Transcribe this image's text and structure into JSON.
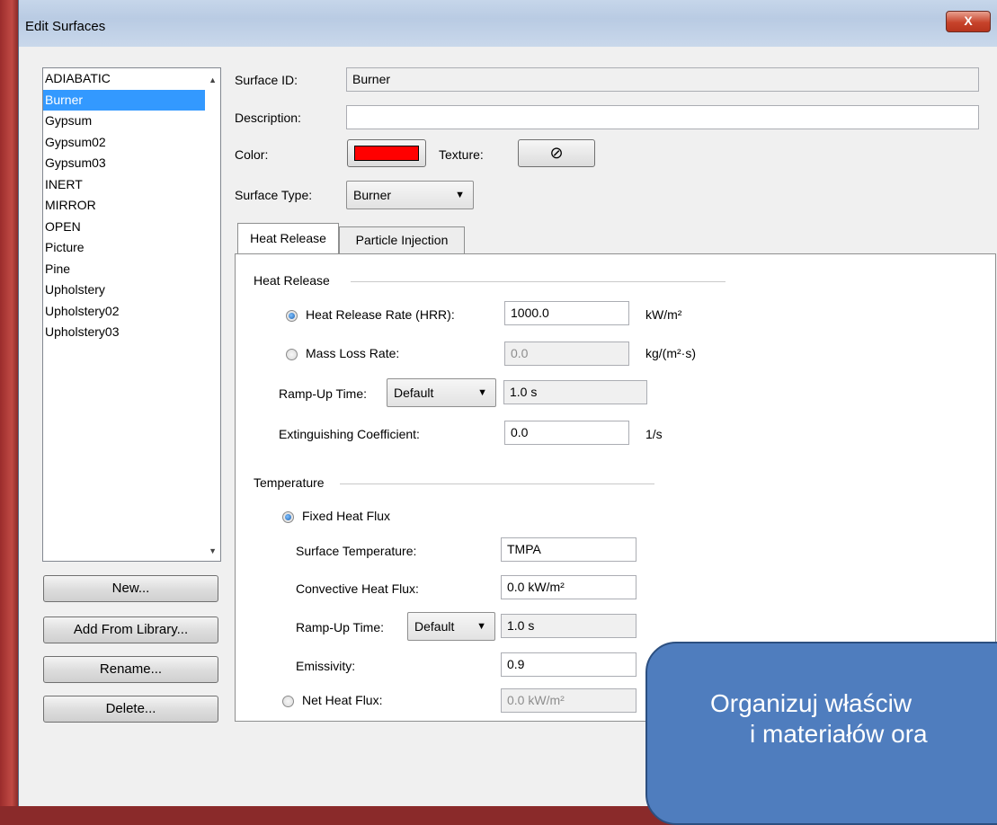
{
  "window": {
    "title": "Edit Surfaces",
    "close_glyph": "X"
  },
  "surface_list": {
    "items": [
      "ADIABATIC",
      "Burner",
      "Gypsum",
      "Gypsum02",
      "Gypsum03",
      "INERT",
      "MIRROR",
      "OPEN",
      "Picture",
      "Pine",
      "Upholstery",
      "Upholstery02",
      "Upholstery03"
    ],
    "selected_index": 1
  },
  "buttons": {
    "new": "New...",
    "add_from_library": "Add From Library...",
    "rename": "Rename...",
    "delete": "Delete..."
  },
  "form": {
    "surface_id_label": "Surface ID:",
    "surface_id_value": "Burner",
    "description_label": "Description:",
    "description_value": "",
    "color_label": "Color:",
    "color_value": "#ff0000",
    "texture_label": "Texture:",
    "texture_icon": "⊘",
    "surface_type_label": "Surface Type:",
    "surface_type_value": "Burner"
  },
  "tabs": [
    {
      "label": "Heat Release",
      "active": true
    },
    {
      "label": "Particle Injection",
      "active": false
    }
  ],
  "heat_release": {
    "group_title": "Heat Release",
    "hrr_label": "Heat Release Rate (HRR):",
    "hrr_value": "1000.0",
    "hrr_unit": "kW/m²",
    "hrr_selected": true,
    "mlr_label": "Mass Loss Rate:",
    "mlr_value": "0.0",
    "mlr_unit": "kg/(m²·s)",
    "ramp_label": "Ramp-Up Time:",
    "ramp_select": "Default",
    "ramp_value": "1.0 s",
    "ext_label": "Extinguishing Coefficient:",
    "ext_value": "0.0",
    "ext_unit": "1/s"
  },
  "temperature": {
    "group_title": "Temperature",
    "fixed_label": "Fixed Heat Flux",
    "fixed_selected": true,
    "surf_temp_label": "Surface Temperature:",
    "surf_temp_value": "TMPA",
    "conv_label": "Convective Heat Flux:",
    "conv_value": "0.0 kW/m²",
    "ramp_label": "Ramp-Up Time:",
    "ramp_select": "Default",
    "ramp_value": "1.0 s",
    "emis_label": "Emissivity:",
    "emis_value": "0.9",
    "net_label": "Net Heat Flux:",
    "net_value": "0.0 kW/m²"
  },
  "overlay": {
    "line1": "Organizuj właściw",
    "line2": "i materiałów ora"
  },
  "colors": {
    "selection": "#3399ff",
    "overlay": "#4f7dbe",
    "swatch": "#ff0000"
  }
}
